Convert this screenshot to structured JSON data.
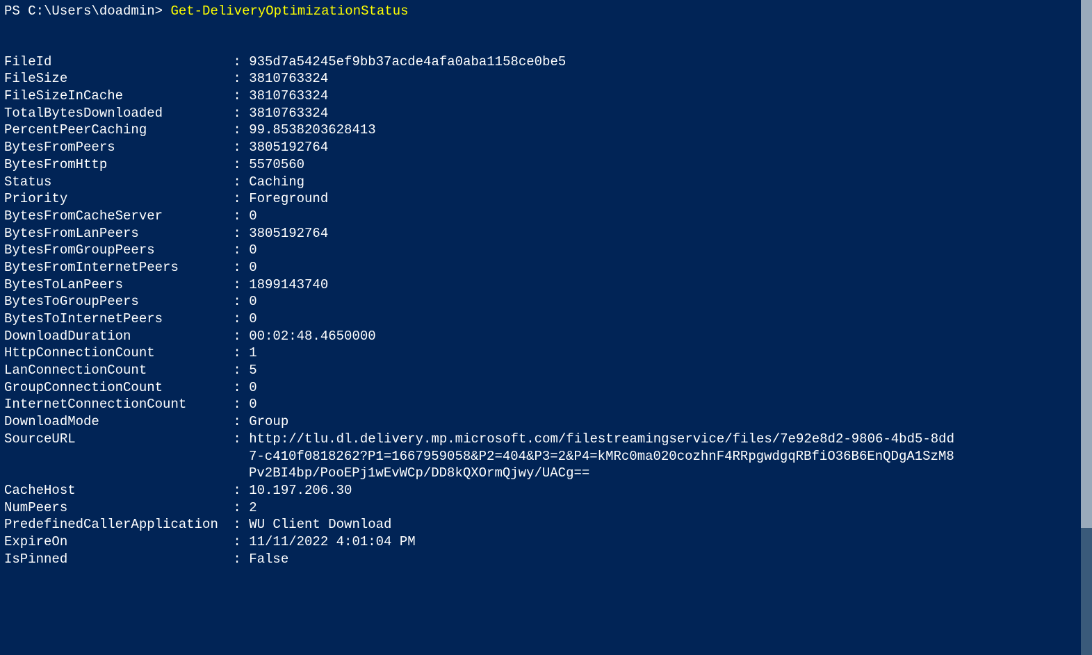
{
  "prompt": {
    "prefix": "PS C:\\Users\\doadmin> ",
    "command": "Get-DeliveryOptimizationStatus"
  },
  "properties": [
    {
      "name": "FileId",
      "value": "935d7a54245ef9bb37acde4afa0aba1158ce0be5"
    },
    {
      "name": "FileSize",
      "value": "3810763324"
    },
    {
      "name": "FileSizeInCache",
      "value": "3810763324"
    },
    {
      "name": "TotalBytesDownloaded",
      "value": "3810763324"
    },
    {
      "name": "PercentPeerCaching",
      "value": "99.8538203628413"
    },
    {
      "name": "BytesFromPeers",
      "value": "3805192764"
    },
    {
      "name": "BytesFromHttp",
      "value": "5570560"
    },
    {
      "name": "Status",
      "value": "Caching"
    },
    {
      "name": "Priority",
      "value": "Foreground"
    },
    {
      "name": "BytesFromCacheServer",
      "value": "0"
    },
    {
      "name": "BytesFromLanPeers",
      "value": "3805192764"
    },
    {
      "name": "BytesFromGroupPeers",
      "value": "0"
    },
    {
      "name": "BytesFromInternetPeers",
      "value": "0"
    },
    {
      "name": "BytesToLanPeers",
      "value": "1899143740"
    },
    {
      "name": "BytesToGroupPeers",
      "value": "0"
    },
    {
      "name": "BytesToInternetPeers",
      "value": "0"
    },
    {
      "name": "DownloadDuration",
      "value": "00:02:48.4650000"
    },
    {
      "name": "HttpConnectionCount",
      "value": "1"
    },
    {
      "name": "LanConnectionCount",
      "value": "5"
    },
    {
      "name": "GroupConnectionCount",
      "value": "0"
    },
    {
      "name": "InternetConnectionCount",
      "value": "0"
    },
    {
      "name": "DownloadMode",
      "value": "Group"
    },
    {
      "name": "SourceURL",
      "value": "http://tlu.dl.delivery.mp.microsoft.com/filestreamingservice/files/7e92e8d2-9806-4bd5-8dd7-c410f0818262?P1=1667959058&P2=404&P3=2&P4=kMRc0ma020cozhnF4RRpgwdgqRBfiO36B6EnQDgA1SzM8Pv2BI4bp/PooEPj1wEvWCp/DD8kQXOrmQjwy/UACg=="
    },
    {
      "name": "CacheHost",
      "value": "10.197.206.30"
    },
    {
      "name": "NumPeers",
      "value": "2"
    },
    {
      "name": "PredefinedCallerApplication",
      "value": "WU Client Download"
    },
    {
      "name": "ExpireOn",
      "value": "11/11/2022 4:01:04 PM"
    },
    {
      "name": "IsPinned",
      "value": "False"
    }
  ],
  "sourceURL_lines": [
    "http://tlu.dl.delivery.mp.microsoft.com/filestreamingservice/files/7e92e8d2-9806-4bd5-8dd",
    "7-c410f0818262?P1=1667959058&P2=404&P3=2&P4=kMRc0ma020cozhnF4RRpgwdgqRBfiO36B6EnQDgA1SzM8",
    "Pv2BI4bp/PooEPj1wEvWCp/DD8kQXOrmQjwy/UACg=="
  ],
  "separator": " : "
}
